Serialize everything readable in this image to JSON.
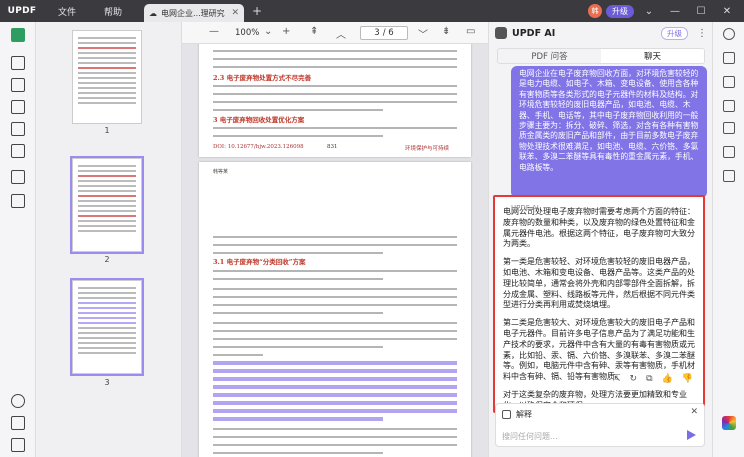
{
  "app": {
    "logo": "UPDF",
    "menu": [
      "文件",
      "帮助"
    ],
    "tab_title": "电网企业...理研究",
    "user_initial": "韩",
    "upgrade_label": "升级"
  },
  "toolbar": {
    "zoom": "100%",
    "current_page": "3",
    "total_pages": "/ 6"
  },
  "thumbnails": [
    {
      "page": "1"
    },
    {
      "page": "2"
    },
    {
      "page": "3"
    }
  ],
  "document": {
    "page1": {
      "heading_a": "2.3 电子废弃物处置方式不尽完善",
      "heading_b": "3 电子废弃物回收处置优化方案",
      "footer_left": "DOI: 10.12677/hjw.2023.126098",
      "footer_mid": "831",
      "footer_right": "环境保护与可持续"
    },
    "page2": {
      "running_head": "韩等某",
      "heading_a": "3.1 电子废弃物“分类回收”方案"
    }
  },
  "ai": {
    "title": "UPDF AI",
    "badge": "升级",
    "tabs": [
      "PDF 问答",
      "聊天"
    ],
    "user_message": "电网企业在电子废弃物回收方面，对环境危害较轻的是电力电缆、如电子、木箱、变电设备、使用含各种有害物质等各类形式的电子元器件的材料及结构。对环境危害较轻的废旧电器产品，如电池、电缆、木器、手机、电话等，其中电子废弃物回收利用的一般步骤主要为：拆分、破碎、筛选，对含有各种有害物质金属类的废旧产品和部件，由于目前多数电子废弃物处理技术很难满足，如电池、电缆、六价铬、多氯联苯、多溴二苯醚等具有毒性的重金属元素，手机、电路板等。",
    "ai_label": "UPDF AI",
    "answer": [
      "电网公司处理电子废弃物时需要考虑两个方面的特征：废弃物的数量和种类，以及废弃物的绿色处置特征和金属元器件电池。根据这两个特征，电子废弃物可大致分为两类。",
      "第一类是危害较轻、对环境危害较轻的废旧电器产品，如电池、木箱和变电设备、电器产品等。这类产品的处理比较简单，通常会将外壳和内部零部件全面拆解，拆分成金属、塑料、线路板等元件，然后根据不同元件类型进行分类再利用或焚烧填埋。",
      "第二类是危害较大、对环境危害较大的废旧电子产品和电子元器件。目前许多电子信息产品为了满足功能和生产技术的要求，元器件中含有大量的有毒有害物质或元素，比如铅、汞、镉、六价铬、多溴联苯、多溴二苯醚等。例如，电脑元件中含有砷、汞等有害物质，手机材料中含有砷、镉、铅等有害物质。",
      "对于这类复杂的废弃物，处理方法要更加精致和专业化，以确保安全和环保。"
    ],
    "context_chip": "解释",
    "input_placeholder": "搜问任何问题..."
  }
}
